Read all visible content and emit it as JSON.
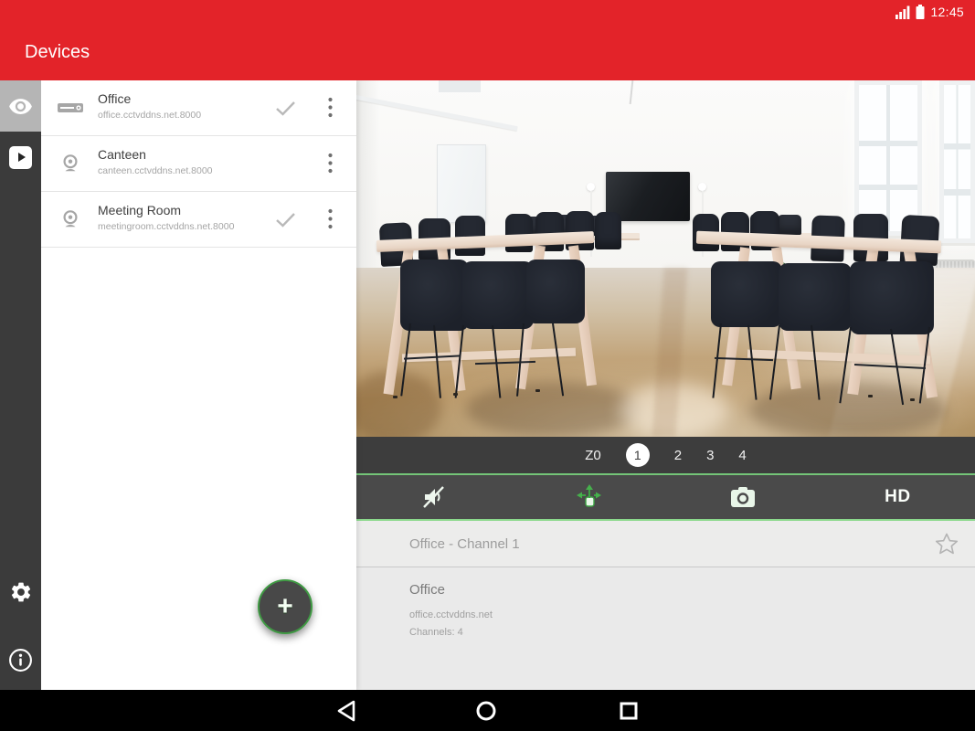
{
  "status_bar": {
    "time": "12:45",
    "signal_icon": "signal-bars-icon",
    "battery_icon": "battery-icon"
  },
  "header": {
    "title": "Devices"
  },
  "sidebar": {
    "items": [
      {
        "id": "live-view",
        "icon": "eye-icon",
        "active": true
      },
      {
        "id": "playback",
        "icon": "play-icon",
        "active": false
      },
      {
        "id": "settings",
        "icon": "gear-icon",
        "active": false
      },
      {
        "id": "about",
        "icon": "info-icon",
        "active": false
      }
    ]
  },
  "device_list": {
    "items": [
      {
        "name": "Office",
        "address": "office.cctvddns.net.8000",
        "type_icon": "dvr-icon",
        "checked": true
      },
      {
        "name": "Canteen",
        "address": "canteen.cctvddns.net.8000",
        "type_icon": "camera-icon",
        "checked": false
      },
      {
        "name": "Meeting Room",
        "address": "meetingroom.cctvddns.net.8000",
        "type_icon": "camera-icon",
        "checked": true
      }
    ],
    "add_button_label": "+"
  },
  "player": {
    "channel_bar": {
      "zoom_label": "Z0",
      "channels": [
        "1",
        "2",
        "3",
        "4"
      ],
      "active_channel": "1"
    },
    "controls": {
      "mute_icon": "muted-speaker-icon",
      "ptz_icon": "ptz-arrows-icon",
      "snapshot_icon": "camera-snapshot-icon",
      "quality_label": "HD"
    }
  },
  "info_panel": {
    "title": "Office - Channel 1",
    "favorite_icon": "star-icon",
    "device_name": "Office",
    "device_address": "office.cctvddns.net",
    "channels_text": "Channels: 4"
  },
  "nav_bar": {
    "back_icon": "back-icon",
    "home_icon": "home-icon",
    "recents_icon": "recents-icon"
  },
  "colors": {
    "accent_red": "#e32329",
    "accent_green": "#43a047",
    "bar_dark": "#4a4a4a",
    "rail_dark": "#3b3b3b"
  }
}
